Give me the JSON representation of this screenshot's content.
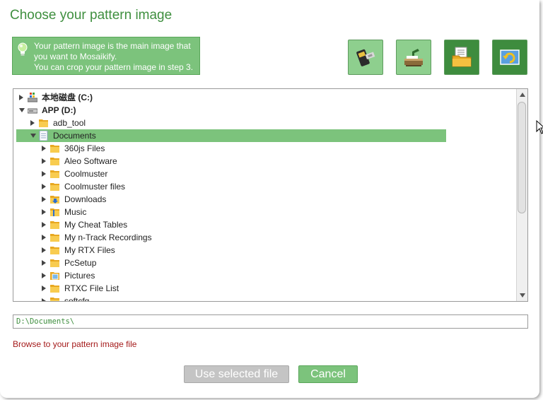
{
  "dialog": {
    "title": "Choose your pattern image",
    "info": {
      "line1": "Your pattern image is the main image that",
      "line2": "you want to Mosaikify.",
      "line3": "You can crop your pattern image in step 3."
    }
  },
  "toolbar": {
    "buttons": [
      {
        "name": "usb-drive-button",
        "icon": "usb-drive-icon"
      },
      {
        "name": "scanner-button",
        "icon": "scanner-icon"
      },
      {
        "name": "browse-folder-button",
        "icon": "folder-document-icon"
      },
      {
        "name": "refresh-button",
        "icon": "refresh-icon"
      }
    ]
  },
  "tree": {
    "items": [
      {
        "label": "本地磁盘 (C:)",
        "indent": 0,
        "arrow": "right",
        "icon": "windows-drive-icon",
        "bold": true
      },
      {
        "label": "APP (D:)",
        "indent": 0,
        "arrow": "down",
        "icon": "drive-icon",
        "bold": true
      },
      {
        "label": "adb_tool",
        "indent": 1,
        "arrow": "right",
        "icon": "folder-icon"
      },
      {
        "label": "Documents",
        "indent": 1,
        "arrow": "down",
        "icon": "documents-folder-icon",
        "selected": true
      },
      {
        "label": "360js Files",
        "indent": 2,
        "arrow": "right",
        "icon": "folder-icon"
      },
      {
        "label": "Aleo Software",
        "indent": 2,
        "arrow": "right",
        "icon": "folder-icon"
      },
      {
        "label": "Coolmuster",
        "indent": 2,
        "arrow": "right",
        "icon": "folder-icon"
      },
      {
        "label": "Coolmuster files",
        "indent": 2,
        "arrow": "right",
        "icon": "folder-icon"
      },
      {
        "label": "Downloads",
        "indent": 2,
        "arrow": "right",
        "icon": "downloads-folder-icon"
      },
      {
        "label": "Music",
        "indent": 2,
        "arrow": "right",
        "icon": "music-folder-icon"
      },
      {
        "label": "My Cheat Tables",
        "indent": 2,
        "arrow": "right",
        "icon": "folder-icon"
      },
      {
        "label": "My n-Track Recordings",
        "indent": 2,
        "arrow": "right",
        "icon": "folder-icon"
      },
      {
        "label": "My RTX Files",
        "indent": 2,
        "arrow": "right",
        "icon": "folder-icon"
      },
      {
        "label": "PcSetup",
        "indent": 2,
        "arrow": "right",
        "icon": "folder-icon"
      },
      {
        "label": "Pictures",
        "indent": 2,
        "arrow": "right",
        "icon": "pictures-folder-icon"
      },
      {
        "label": "RTXC File List",
        "indent": 2,
        "arrow": "right",
        "icon": "folder-icon"
      },
      {
        "label": "softcfg",
        "indent": 2,
        "arrow": "right",
        "icon": "folder-icon"
      }
    ]
  },
  "path": {
    "value": "D:\\Documents\\"
  },
  "hint": "Browse to your pattern image file",
  "buttons": {
    "use_selected": "Use selected file",
    "cancel": "Cancel"
  },
  "colors": {
    "accent": "#7cc37c",
    "accent_dark": "#3e8c3e",
    "title": "#3f8f3f",
    "hint": "#a41a1a"
  }
}
